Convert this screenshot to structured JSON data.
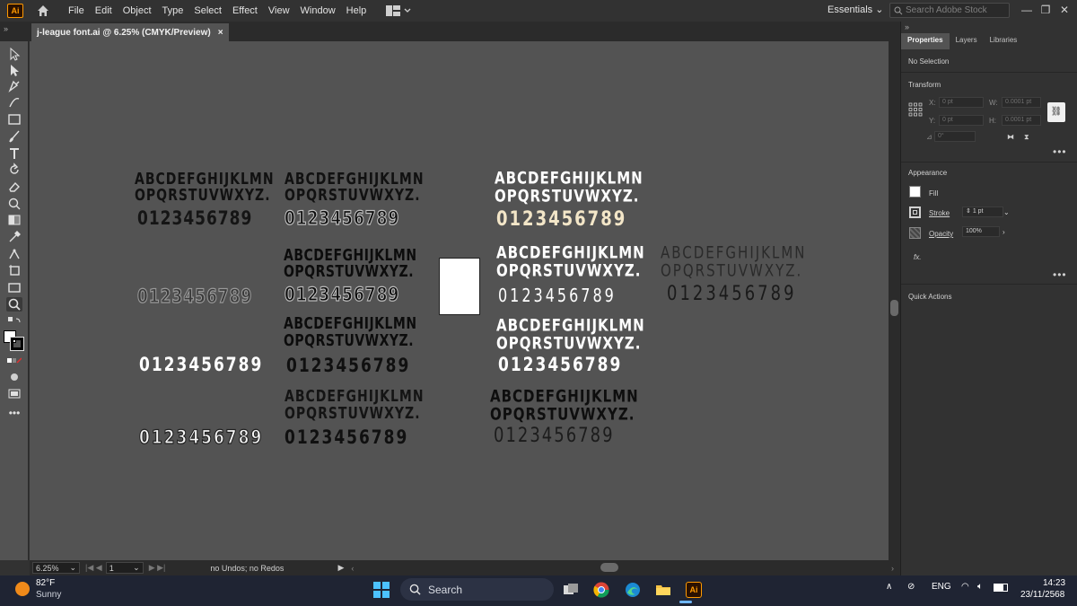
{
  "app": {
    "logo": "Ai",
    "colors": {
      "accent": "#ff9a00",
      "canvas": "#535353",
      "chrome": "#323232"
    }
  },
  "menu": {
    "items": [
      "File",
      "Edit",
      "Object",
      "Type",
      "Select",
      "Effect",
      "View",
      "Window",
      "Help"
    ]
  },
  "workspace": {
    "label": "Essentials"
  },
  "stock_search": {
    "placeholder": "Search Adobe Stock"
  },
  "document_tab": {
    "title": "j-league font.ai @ 6.25% (CMYK/Preview)",
    "close": "×"
  },
  "status_bar": {
    "zoom": "6.25%",
    "artboard": "1",
    "undo_info": "no Undos; no Redos"
  },
  "panel": {
    "tabs": [
      "Properties",
      "Layers",
      "Libraries"
    ],
    "selection": "No Selection",
    "transform": {
      "title": "Transform",
      "x_label": "X:",
      "x_value": "0 pt",
      "y_label": "Y:",
      "y_value": "0 pt",
      "w_label": "W:",
      "w_value": "0.0001 pt",
      "h_label": "H:",
      "h_value": "0.0001 pt",
      "angle": "0°"
    },
    "appearance": {
      "title": "Appearance",
      "fill_label": "Fill",
      "stroke_label": "Stroke",
      "stroke_value": "1 pt",
      "opacity_label": "Opacity",
      "opacity_value": "100%",
      "fx": "fx."
    },
    "quick_actions": "Quick Actions"
  },
  "specimens": {
    "upper1": "ABCDEFGHIJKLMN",
    "upper2": "OPQRSTUVWXYZ.",
    "digits": "0123456789"
  },
  "taskbar": {
    "weather_temp": "82°F",
    "weather_cond": "Sunny",
    "search_label": "Search",
    "lang": "ENG",
    "time": "14:23",
    "date": "23/11/2568"
  }
}
